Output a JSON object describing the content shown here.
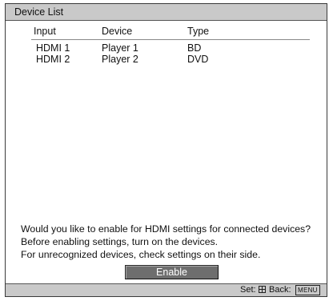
{
  "window": {
    "title": "Device List"
  },
  "table": {
    "columns": [
      "Input",
      "Device",
      "Type"
    ],
    "rows": [
      {
        "input": "HDMI 1",
        "device": "Player 1",
        "type": "BD"
      },
      {
        "input": "HDMI 2",
        "device": "Player 2",
        "type": "DVD"
      }
    ]
  },
  "message": {
    "line1": "Would you like to enable for HDMI settings for connected devices?",
    "line2": "Before enabling settings, turn on the devices.",
    "line3": "For unrecognized devices, check settings on their side."
  },
  "actions": {
    "enable_label": "Enable"
  },
  "footer": {
    "set_label": "Set:",
    "back_label": "Back:",
    "menu_key": "MENU"
  }
}
